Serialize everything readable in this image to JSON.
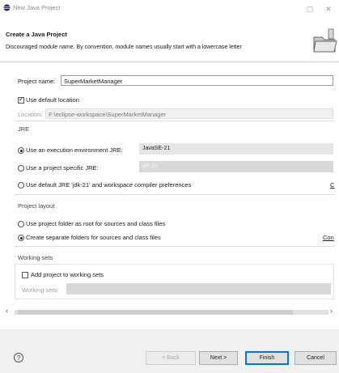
{
  "window": {
    "title": "New Java Project",
    "minimize": "▢",
    "close": "✕"
  },
  "header": {
    "title": "Create a Java Project",
    "description": "Discouraged module name. By convention, module names usually start with a lowercase letter"
  },
  "project": {
    "name_label": "Project name:",
    "name_value": "SuperMarketManager",
    "use_default_location_label": "Use default location",
    "use_default_location_checked": true,
    "location_label": "Location:",
    "location_value": "F:\\eclipse-workspace\\SuperMarketManager"
  },
  "jre": {
    "section_label": "JRE",
    "options": [
      {
        "label": "Use an execution environment JRE:",
        "selected": true,
        "combo": "JavaSE-21"
      },
      {
        "label": "Use a project specific JRE:",
        "selected": false,
        "combo": "jdk-21"
      },
      {
        "label": "Use default JRE 'jdk-21' and workspace compiler preferences",
        "selected": false,
        "link": "C"
      }
    ]
  },
  "layout": {
    "section_label": "Project layout",
    "options": [
      {
        "label": "Use project folder as root for sources and class files",
        "selected": false
      },
      {
        "label": "Create separate folders for sources and class files",
        "selected": true,
        "link": "Con"
      }
    ]
  },
  "working_sets": {
    "section_label": "Working sets",
    "add_label": "Add project to working sets",
    "add_checked": false,
    "field_label": "Working sets:"
  },
  "scroll": {
    "left": "‹",
    "right": "›"
  },
  "footer": {
    "help": "?",
    "back": "< Back",
    "next": "Next >",
    "finish": "Finish",
    "cancel": "Cancel"
  }
}
